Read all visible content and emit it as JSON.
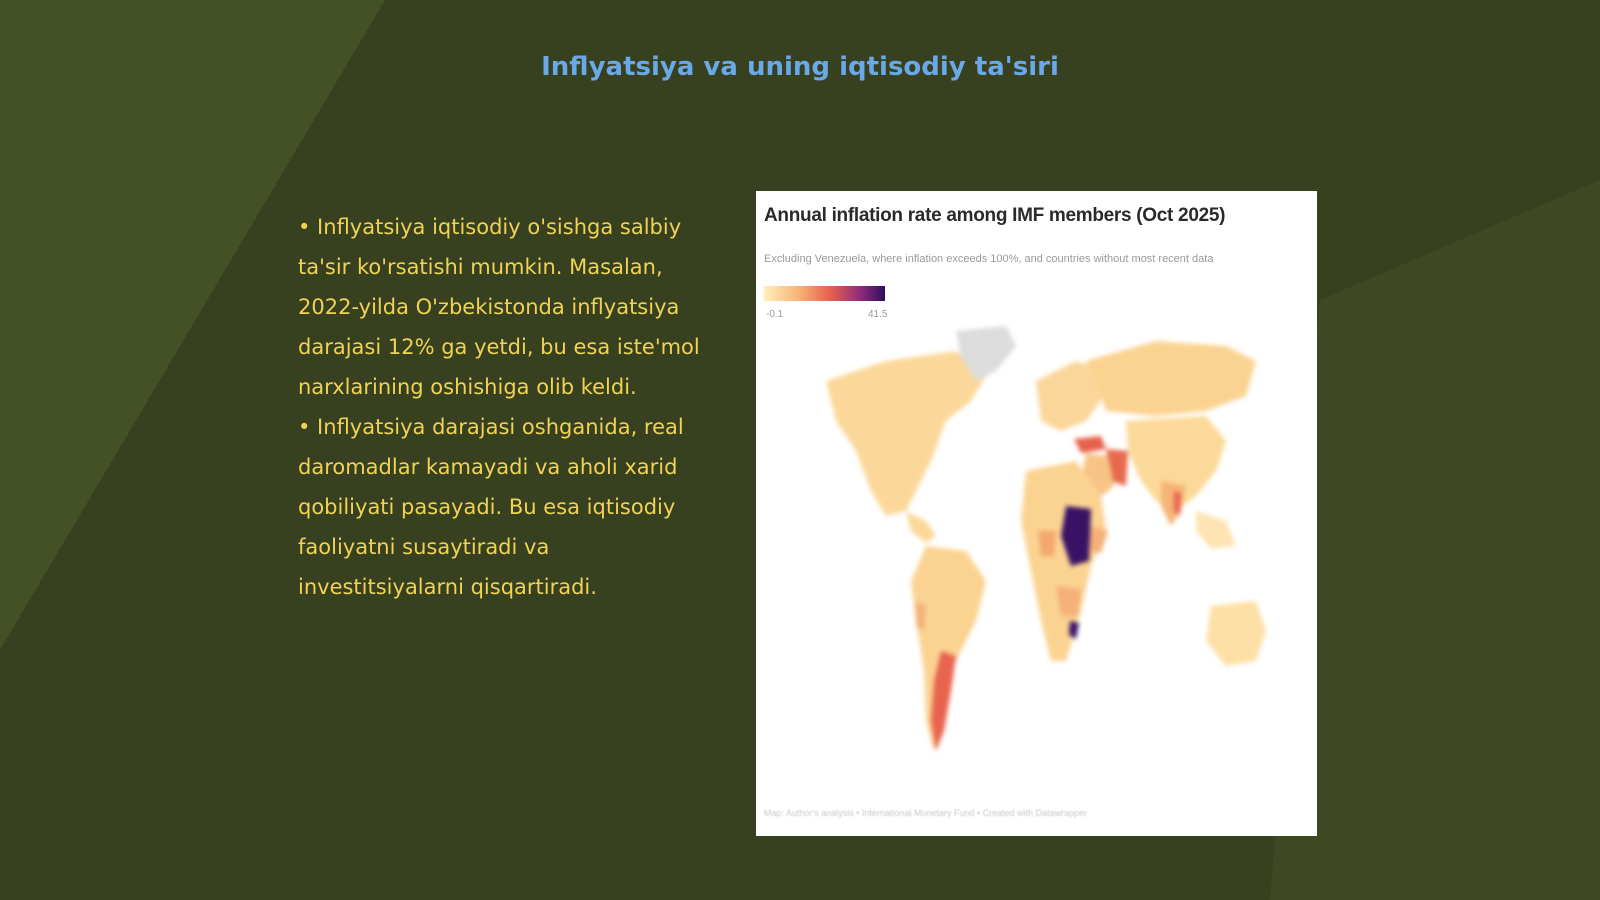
{
  "slide": {
    "title": "Inflyatsiya va uning iqtisodiy ta'siri",
    "bullets": [
      "• Inflyatsiya iqtisodiy o'sishga salbiy ta'sir ko'rsatishi mumkin. Masalan, 2022-yilda O'zbekistonda inflyatsiya darajasi 12% ga yetdi, bu esa iste'mol narxlarining oshishiga olib keldi.",
      "• Inflyatsiya darajasi oshganida, real daromadlar kamayadi va aholi xarid qobiliyati pasayadi. Bu esa iqtisodiy faoliyatni susaytiradi va investitsiyalarni qisqartiradi."
    ]
  },
  "map_image": {
    "title": "Annual inflation rate among IMF members (Oct 2025)",
    "subtitle": "Excluding Venezuela, where inflation exceeds 100%, and countries without most recent data",
    "legend": {
      "min_label": "-0.1",
      "max_label": "41.5"
    },
    "source": "Map: Author's analysis • International Monetary Fund • Created with Datawrapper"
  },
  "colors": {
    "background": "#37401f",
    "title": "#6aa8e8",
    "bullet_text": "#f0d354"
  }
}
